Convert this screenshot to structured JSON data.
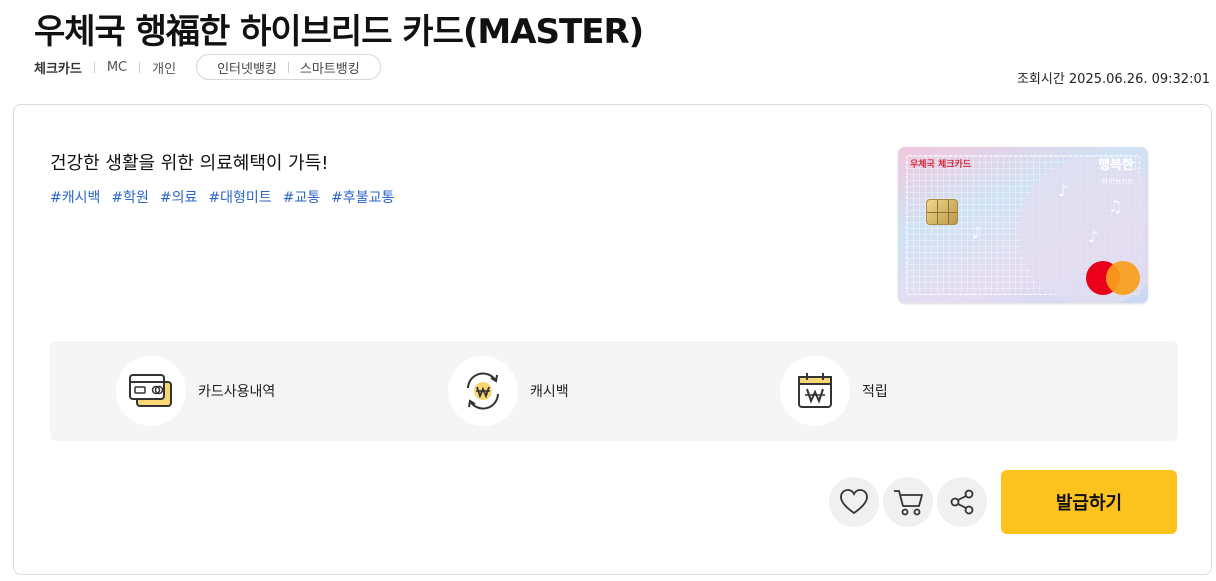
{
  "title": "우체국 행福한 하이브리드 카드(MASTER)",
  "meta": {
    "card_type": "체크카드",
    "brand": "MC",
    "audience": "개인",
    "channels": [
      "인터넷뱅킹",
      "스마트뱅킹"
    ]
  },
  "timestamp": "조회시간 2025.06.26. 09:32:01",
  "main": {
    "headline": "건강한 생활을 위한 의료혜택이 가득!",
    "tags": [
      "#캐시백",
      "#학원",
      "#의료",
      "#대형미트",
      "#교통",
      "#후불교통"
    ]
  },
  "card_image": {
    "brand_text": "우체국 체크카드",
    "name": "행복한",
    "sub": "하이브리드",
    "network": "mastercard",
    "colors": {
      "pink": "#f2c6df",
      "blue": "#cfe3f4",
      "mc_red": "#eb001b",
      "mc_orange": "#f79e1b"
    }
  },
  "benefits": [
    {
      "label": "카드사용내역",
      "icon": "credit-card-icon"
    },
    {
      "label": "캐시백",
      "icon": "cashback-won-icon"
    },
    {
      "label": "적립",
      "icon": "calendar-won-icon"
    }
  ],
  "actions": {
    "like_icon": "heart-icon",
    "cart_icon": "cart-icon",
    "share_icon": "share-icon",
    "issue_label": "발급하기"
  },
  "colors": {
    "accent": "#fcc21d",
    "tag_blue": "#2b66c7",
    "benefit_bg": "#f5f5f5",
    "icon_yellow": "#f7d774"
  }
}
